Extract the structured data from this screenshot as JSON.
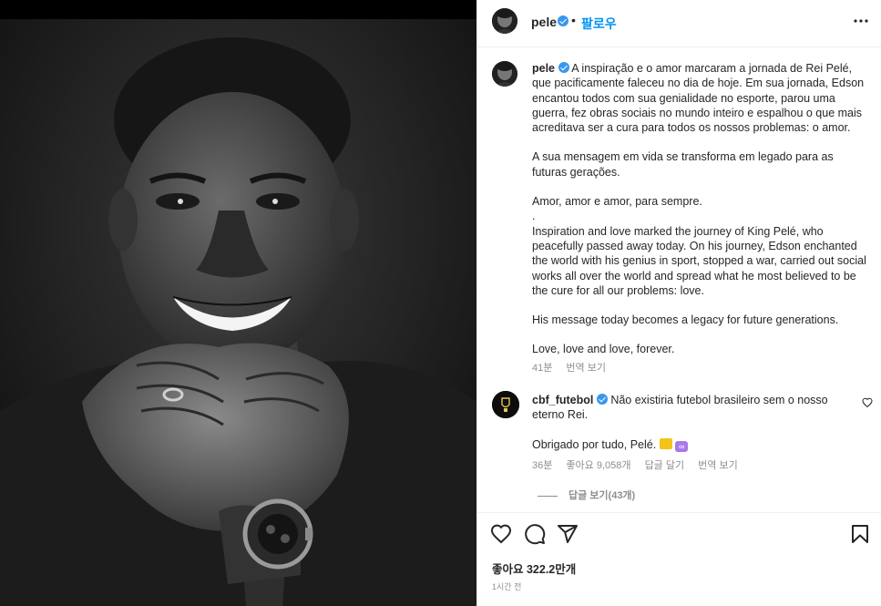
{
  "post": {
    "author": "pele",
    "follow_label": "팔로우",
    "separator": "•"
  },
  "caption": {
    "username": "pele",
    "text_lines": [
      "A inspiração e o amor marcaram a jornada de Rei Pelé, que pacificamente faleceu no dia de hoje. Em sua jornada, Edson encantou todos com sua genialidade no esporte, parou uma guerra, fez obras sociais no mundo inteiro e espalhou o que mais acreditava ser a cura para todos os nossos problemas: o amor.",
      "A sua mensagem em vida se transforma em legado para as futuras gerações.",
      "Amor, amor e amor, para sempre.",
      ".",
      "Inspiration and love marked the journey of King Pelé, who peacefully passed away today. On his journey, Edson enchanted the world with his genius in sport, stopped a war, carried out social works all over the world and spread what he most believed to be the cure for all our problems: love.",
      "His message today becomes a legacy for future generations.",
      "Love, love and love, forever."
    ],
    "time": "41분",
    "translate_label": "번역 보기"
  },
  "comment": {
    "username": "cbf_futebol",
    "text": "Não existiria futebol brasileiro sem o nosso eterno Rei.",
    "text2": "Obrigado por tudo, Pelé.",
    "emojis": [
      "crown-emoji",
      "infinity-emoji"
    ],
    "time": "36분",
    "likes": "좋아요 9,058개",
    "reply_label": "답글 달기",
    "translate_label": "번역 보기",
    "view_replies": "답글 보기(43개)"
  },
  "footer": {
    "likes": "좋아요 322.2만개",
    "time": "1시간 전"
  },
  "icons": {
    "header": [
      "avatar",
      "verified-badge-icon",
      "more-options-icon"
    ],
    "actions": [
      "heart-icon",
      "comment-icon",
      "share-icon",
      "bookmark-icon"
    ]
  },
  "colors": {
    "link_blue": "#0095f6",
    "verified_blue": "#3897f0",
    "meta_gray": "#8e8e8e",
    "text": "#262626"
  }
}
